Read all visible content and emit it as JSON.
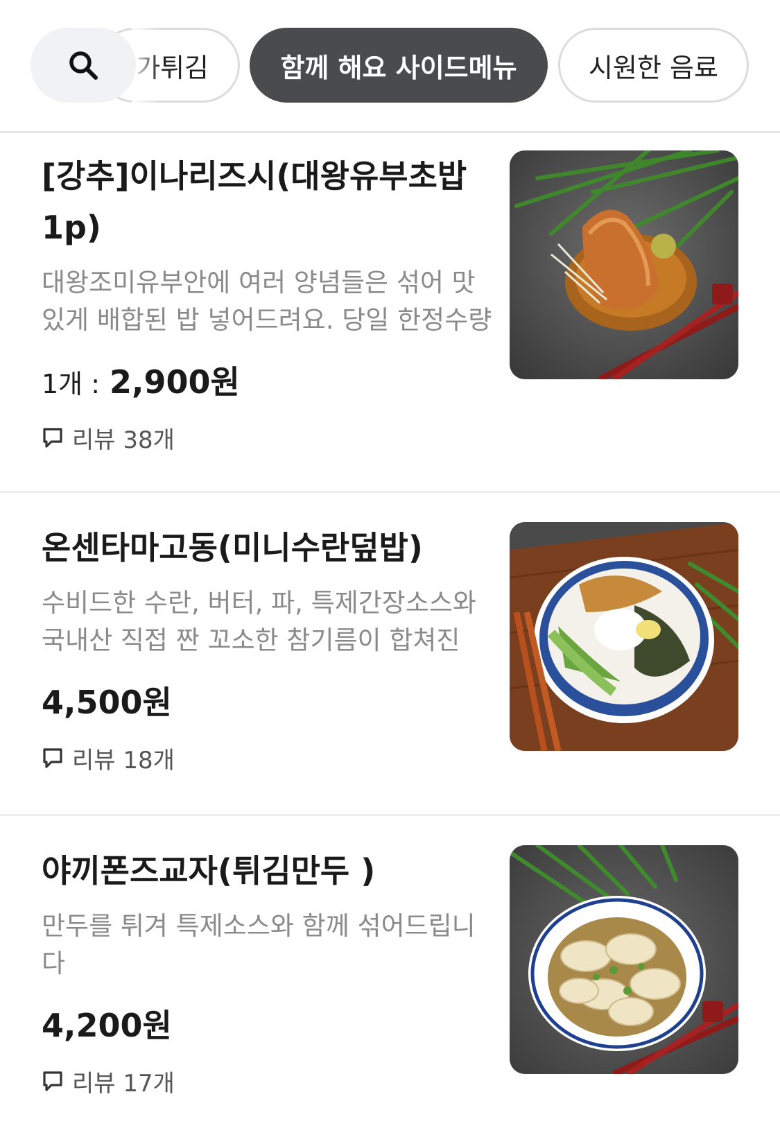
{
  "categories": {
    "partial_label": "가튀김",
    "active_label": "함께 해요 사이드메뉴",
    "next_label": "시원한 음료"
  },
  "icons": {
    "search": "search-icon",
    "review": "speech-bubble-icon"
  },
  "colors": {
    "active_chip": "#4a4b4d",
    "chip_border": "#dcdcdc",
    "desc": "#8a8a8a"
  },
  "menu": {
    "items": [
      {
        "name": "[강추]이나리즈시(대왕유부초밥1p)",
        "description": "대왕조미유부안에 여러 양념들은 섞어 맛있게 배합된 밥 넣어드려요. 당일 한정수량",
        "price_prefix": "1개 :",
        "price": "2,900원",
        "review": "리뷰 38개"
      },
      {
        "name": "온센타마고동(미니수란덮밥)",
        "description": "수비드한 수란, 버터, 파, 특제간장소스와 국내산 직접 짠 꼬소한 참기름이 합쳐진",
        "price": "4,500원",
        "review": "리뷰 18개"
      },
      {
        "name": "야끼폰즈교자(튀김만두 )",
        "description": "만두를  튀겨  특제소스와 함께 섞어드립니다",
        "price": "4,200원",
        "review": "리뷰 17개"
      }
    ]
  }
}
